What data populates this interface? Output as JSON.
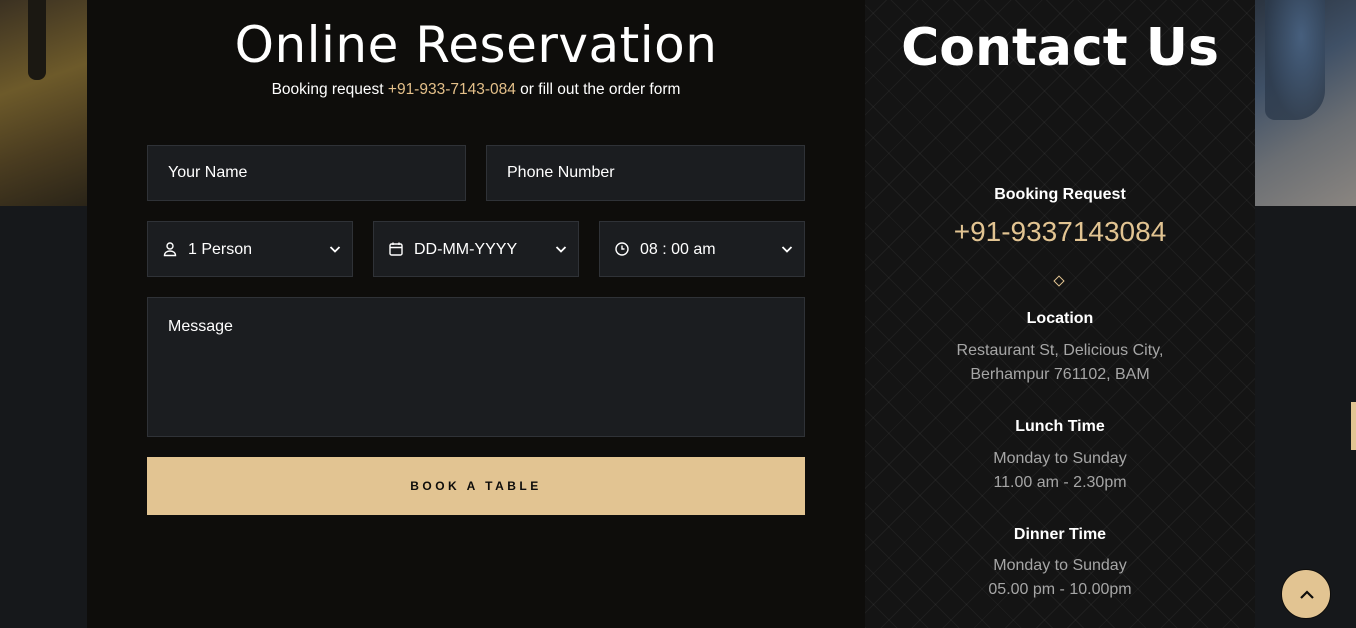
{
  "reservation": {
    "title": "Online Reservation",
    "subtitle_before": "Booking request ",
    "subtitle_phone": "+91-933-7143-084",
    "subtitle_after": " or fill out the order form",
    "name_placeholder": "Your Name",
    "phone_placeholder": "Phone Number",
    "person_value": "1 Person",
    "date_value": "DD-MM-YYYY",
    "time_value": "08 : 00 am",
    "message_placeholder": "Message",
    "submit_label": "BOOK A TABLE"
  },
  "contact": {
    "title": "Contact Us",
    "booking_heading": "Booking Request",
    "booking_phone": "+91-9337143084",
    "location_heading": "Location",
    "location_line1": "Restaurant St, Delicious City,",
    "location_line2": "Berhampur 761102, BAM",
    "lunch_heading": "Lunch Time",
    "lunch_days": "Monday to Sunday",
    "lunch_hours": "11.00 am - 2.30pm",
    "dinner_heading": "Dinner Time",
    "dinner_days": "Monday to Sunday",
    "dinner_hours": "05.00 pm - 10.00pm"
  },
  "icons": {
    "person": "user-icon",
    "date": "calendar-icon",
    "time": "clock-icon",
    "dropdown": "chevron-down-icon",
    "back_to_top": "chevron-up-icon"
  },
  "colors": {
    "accent": "#e2c492",
    "panel": "#0e0d0b",
    "field": "#1b1d20"
  }
}
